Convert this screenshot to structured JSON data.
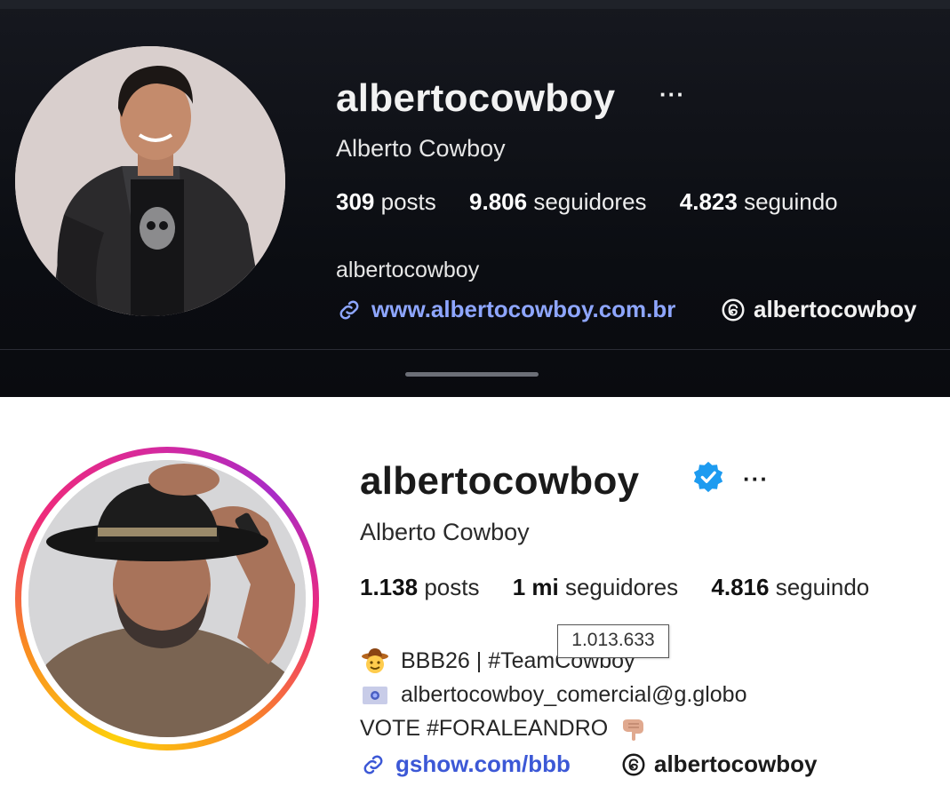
{
  "top_profile": {
    "username": "albertocowboy",
    "more_label": "···",
    "full_name": "Alberto Cowboy",
    "stats": {
      "posts_count": "309",
      "posts_label": "posts",
      "followers_count": "9.806",
      "followers_label": "seguidores",
      "following_count": "4.823",
      "following_label": "seguindo"
    },
    "bio": "albertocowboy",
    "link_text": "www.albertocowboy.com.br",
    "threads_handle": "albertocowboy"
  },
  "bottom_profile": {
    "username": "albertocowboy",
    "verified": true,
    "more_label": "···",
    "full_name": "Alberto Cowboy",
    "stats": {
      "posts_count": "1.138",
      "posts_label": "posts",
      "followers_count": "1 mi",
      "followers_label": "seguidores",
      "following_count": "4.816",
      "following_label": "seguindo"
    },
    "followers_tooltip": "1.013.633",
    "bio_lines": [
      {
        "icon": "cowboy-emoji-icon",
        "text": "BBB26 | #TeamCowboy"
      },
      {
        "icon": "id-card-emoji-icon",
        "text": "albertocowboy_comercial@g.globo"
      },
      {
        "icon": "pointing-down-emoji-icon",
        "text": "VOTE #FORALEANDRO"
      }
    ],
    "link_text": "gshow.com/bbb",
    "threads_handle": "albertocowboy"
  },
  "colors": {
    "dark_background": "#0b0d12",
    "dark_link": "#8ea6ff",
    "light_link": "#3c58d6",
    "verified_badge": "#1d9bf0"
  }
}
